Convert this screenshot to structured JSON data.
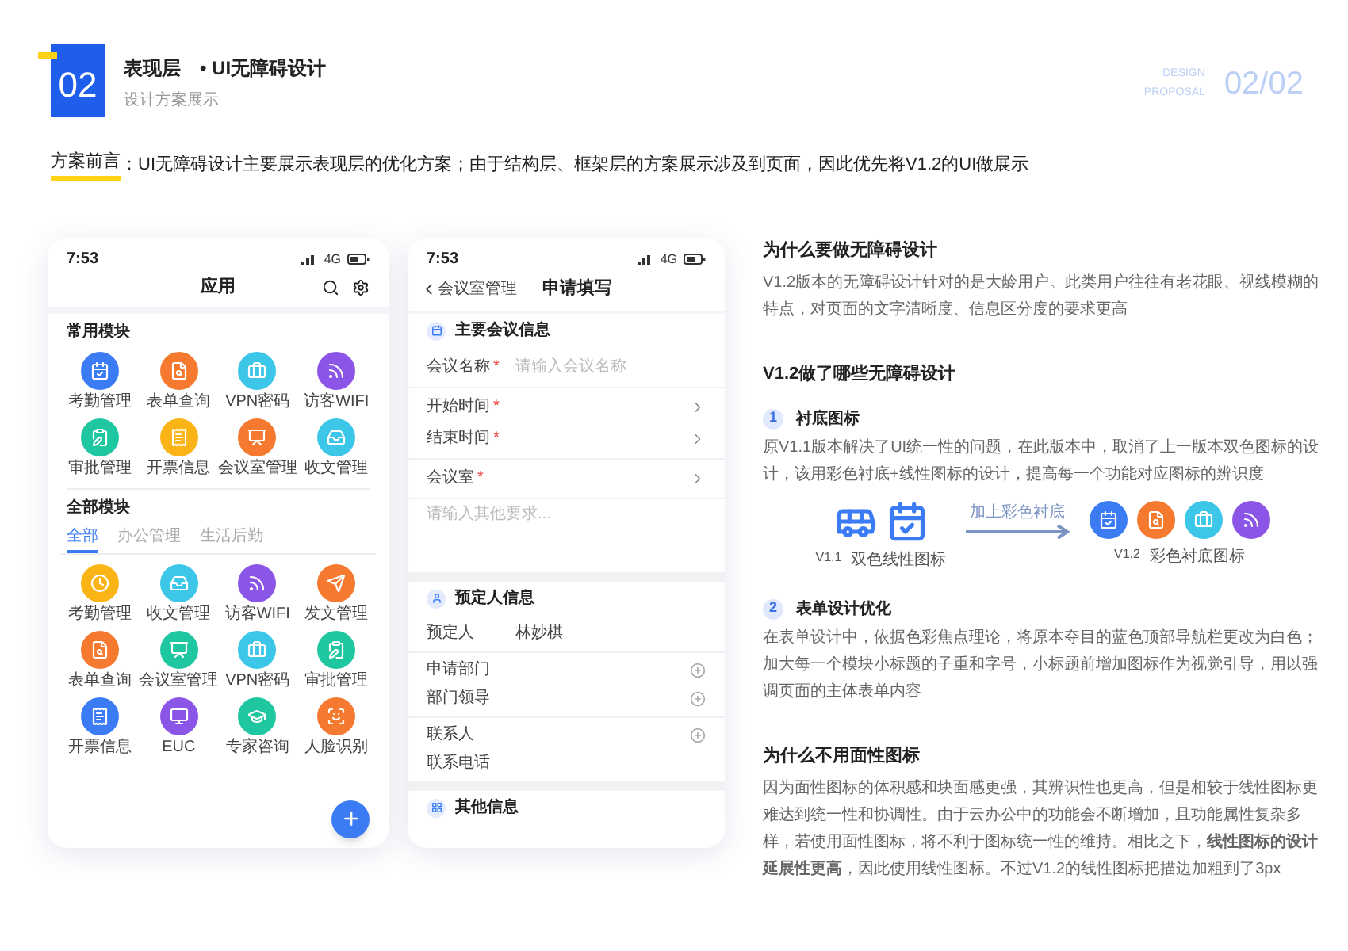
{
  "header": {
    "number": "02",
    "title": "表现层",
    "subtitle_dot": "•",
    "subtitle": "UI无障碍设计",
    "caption": "设计方案展示",
    "tag_lines": [
      "DESIGN",
      "PROPOSAL"
    ],
    "page": "02/02"
  },
  "intro": {
    "label": "方案前言",
    "text": "：UI无障碍设计主要展示表现层的优化方案；由于结构层、框架层的方案展示涉及到页面，因此优先将V1.2的UI做展示"
  },
  "phone_apps": {
    "time": "7:53",
    "network": "4G",
    "title": "应用",
    "common": {
      "title": "常用模块",
      "modules": [
        {
          "label": "考勤管理",
          "color": "#3b7cf5"
        },
        {
          "label": "表单查询",
          "color": "#f57a2f"
        },
        {
          "label": "VPN密码",
          "color": "#3cc6e8"
        },
        {
          "label": "访客WIFI",
          "color": "#8b55e8"
        },
        {
          "label": "审批管理",
          "color": "#1fc7a1"
        },
        {
          "label": "开票信息",
          "color": "#fbb416"
        },
        {
          "label": "会议室管理",
          "color": "#f57a2f"
        },
        {
          "label": "收文管理",
          "color": "#3cc6e8"
        }
      ]
    },
    "all": {
      "title": "全部模块",
      "tabs": [
        {
          "label": "全部",
          "selected": true
        },
        {
          "label": "办公管理",
          "selected": false
        },
        {
          "label": "生活后勤",
          "selected": false
        }
      ],
      "modules": [
        {
          "label": "考勤管理",
          "color": "#fbb416"
        },
        {
          "label": "收文管理",
          "color": "#3cc6e8"
        },
        {
          "label": "访客WIFI",
          "color": "#8b55e8"
        },
        {
          "label": "发文管理",
          "color": "#f57a2f"
        },
        {
          "label": "表单查询",
          "color": "#f57a2f"
        },
        {
          "label": "会议室管理",
          "color": "#1fc7a1"
        },
        {
          "label": "VPN密码",
          "color": "#3cc6e8"
        },
        {
          "label": "审批管理",
          "color": "#1fc7a1"
        },
        {
          "label": "开票信息",
          "color": "#3b7cf5"
        },
        {
          "label": "EUC",
          "color": "#8b55e8"
        },
        {
          "label": "专家咨询",
          "color": "#1fc7a1"
        },
        {
          "label": "人脸识别",
          "color": "#f57a2f"
        }
      ]
    }
  },
  "phone_form": {
    "time": "7:53",
    "network": "4G",
    "back": "会议室管理",
    "title": "申请填写",
    "sections": [
      {
        "title": "主要会议信息",
        "groups": [
          [
            {
              "kind": "input",
              "label": "会议名称",
              "required_mark": "*",
              "placeholder": "请输入会议名称"
            }
          ],
          [
            {
              "kind": "select",
              "label": "开始时间",
              "required_mark": "*"
            },
            {
              "kind": "select",
              "label": "结束时间",
              "required_mark": "*"
            }
          ],
          [
            {
              "kind": "select",
              "label": "会议室",
              "required_mark": "*"
            }
          ],
          [
            {
              "kind": "textarea",
              "placeholder": "请输入其他要求..."
            }
          ]
        ]
      },
      {
        "title": "预定人信息",
        "groups": [
          [
            {
              "kind": "value",
              "label": "预定人",
              "value": "林妙棋"
            }
          ],
          [
            {
              "kind": "add",
              "label": "申请部门"
            },
            {
              "kind": "add",
              "label": "部门领导"
            }
          ],
          [
            {
              "kind": "add",
              "label": "联系人"
            },
            {
              "kind": "plain",
              "label": "联系电话"
            }
          ]
        ]
      },
      {
        "title": "其他信息"
      }
    ]
  },
  "notes": [
    {
      "kind": "heading",
      "text": "为什么要做无障碍设计"
    },
    {
      "kind": "paragraph",
      "text": "V1.2版本的无障碍设计针对的是大龄用户。此类用户往往有老花眼、视线模糊的特点，对页面的文字清晰度、信息区分度的要求更高"
    },
    {
      "kind": "heading",
      "text": "V1.2做了哪些无障碍设计"
    },
    {
      "kind": "numbered",
      "number": "1",
      "text": "衬底图标"
    },
    {
      "kind": "paragraph",
      "text": "原V1.1版本解决了UI统一性的问题，在此版本中，取消了上一版本双色图标的设计，该用彩色衬底+线性图标的设计，提高每一个功能对应图标的辨识度"
    },
    {
      "kind": "diagram",
      "arrow_label": "加上彩色衬底",
      "before_version": "V1.1",
      "before_caption": "双色线性图标",
      "after_version": "V1.2",
      "after_caption": "彩色衬底图标",
      "after_icons": [
        {
          "color": "#3b7cf5"
        },
        {
          "color": "#f57a2f"
        },
        {
          "color": "#3cc6e8"
        },
        {
          "color": "#8b55e8"
        }
      ]
    },
    {
      "kind": "numbered",
      "number": "2",
      "text": "表单设计优化"
    },
    {
      "kind": "paragraph",
      "text": "在表单设计中，依据色彩焦点理论，将原本夺目的蓝色顶部导航栏更改为白色；加大每一个模块小标题的子重和字号，小标题前增加图标作为视觉引导，用以强调页面的主体表单内容"
    },
    {
      "kind": "heading",
      "text": "为什么不用面性图标"
    },
    {
      "kind": "paragraph",
      "text": "因为面性图标的体积感和块面感更强，其辨识性也更高，但是相较于线性图标更难达到统一性和协调性。由于云办公中的功能会不断增加，且功能属性复杂多样，若使用面性图标，将不利于图标统一性的维持。相比之下，**线性图标的设计延展性更高**，因此使用线性图标。不过V1.2的线性图标把描边加粗到了3px"
    }
  ]
}
